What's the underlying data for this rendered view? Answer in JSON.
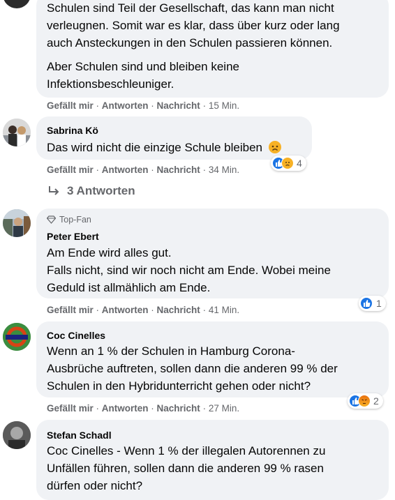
{
  "actions": {
    "like": "Gefällt mir",
    "reply": "Antworten",
    "message": "Nachricht",
    "separator": " · "
  },
  "comments": [
    {
      "name": "",
      "lines": [
        "Schulen sind Teil der Gesellschaft, das kann man nicht",
        "verleugnen. Somit war es klar, dass über kurz oder lang",
        "auch Ansteckungen in den Schulen passieren können."
      ],
      "lines2": [
        "Aber Schulen sind und bleiben keine",
        "Infektionsbeschleuniger."
      ],
      "time": "15 Min."
    },
    {
      "name": "Sabrina Kö",
      "lines": [
        "Das wird nicht die einzige Schule bleiben"
      ],
      "time": "34 Min.",
      "reaction_count": "4"
    },
    {
      "replies_label": "3 Antworten"
    },
    {
      "badge": "Top-Fan",
      "name": "Peter Ebert",
      "lines": [
        "Am Ende wird alles gut.",
        "Falls nicht, sind wir noch nicht am Ende. Wobei meine",
        "Geduld ist allmählich am Ende."
      ],
      "time": "41 Min.",
      "reaction_count": "1"
    },
    {
      "name": "Coc Cinelles",
      "lines": [
        "Wenn an 1 % der Schulen in Hamburg Corona-",
        "Ausbrüche auftreten, sollen dann die anderen 99 % der",
        "Schulen in den Hybridunterricht gehen oder nicht?"
      ],
      "time": "27 Min.",
      "reaction_count": "2"
    },
    {
      "name": "Stefan Schadl",
      "lines": [
        "Coc Cinelles - Wenn 1 % der illegalen Autorennen zu",
        "Unfällen führen, sollen dann die anderen 99 % rasen",
        "dürfen oder nicht?"
      ]
    }
  ],
  "colors": {
    "like": "#1b74e4",
    "sad": "#f7b125",
    "angry": "#e9710f",
    "bubble": "#f0f2f5",
    "meta": "#65676b"
  }
}
